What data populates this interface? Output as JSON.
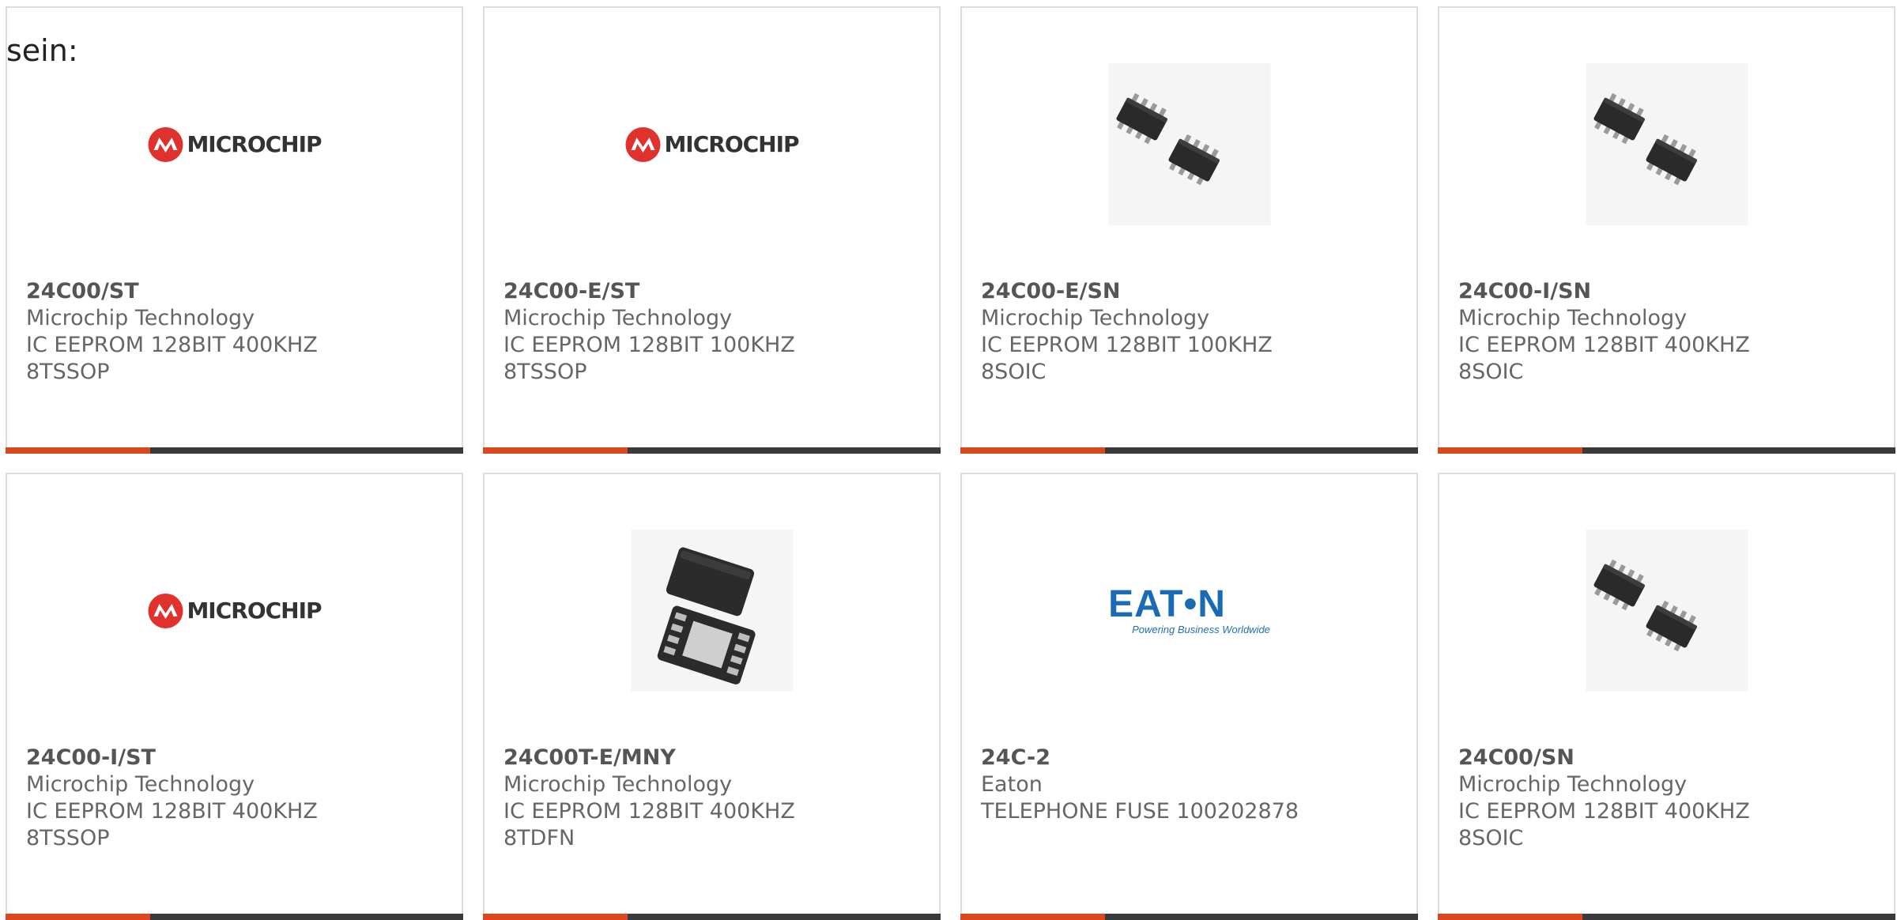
{
  "intro_text": "sein:",
  "colors": {
    "accent": "#d9481f",
    "bar": "#3a3a3a",
    "microchip_red": "#e0312d",
    "eaton_blue": "#1a6bb5"
  },
  "products": [
    {
      "part_number": "24C00/ST",
      "manufacturer": "Microchip Technology",
      "desc1": "IC EEPROM 128BIT 400KHZ",
      "desc2": "8TSSOP",
      "image": "microchip-logo"
    },
    {
      "part_number": "24C00-E/ST",
      "manufacturer": "Microchip Technology",
      "desc1": "IC EEPROM 128BIT 100KHZ",
      "desc2": "8TSSOP",
      "image": "microchip-logo"
    },
    {
      "part_number": "24C00-E/SN",
      "manufacturer": "Microchip Technology",
      "desc1": "IC EEPROM 128BIT 100KHZ",
      "desc2": "8SOIC",
      "image": "soic-chip-photo"
    },
    {
      "part_number": "24C00-I/SN",
      "manufacturer": "Microchip Technology",
      "desc1": "IC EEPROM 128BIT 400KHZ",
      "desc2": "8SOIC",
      "image": "soic-chip-photo"
    },
    {
      "part_number": "24C00-I/ST",
      "manufacturer": "Microchip Technology",
      "desc1": "IC EEPROM 128BIT 400KHZ",
      "desc2": "8TSSOP",
      "image": "microchip-logo"
    },
    {
      "part_number": "24C00T-E/MNY",
      "manufacturer": "Microchip Technology",
      "desc1": "IC EEPROM 128BIT 400KHZ",
      "desc2": "8TDFN",
      "image": "tdfn-chip-photo"
    },
    {
      "part_number": "24C-2",
      "manufacturer": "Eaton",
      "desc1": "TELEPHONE FUSE 100202878",
      "desc2": "",
      "image": "eaton-logo"
    },
    {
      "part_number": "24C00/SN",
      "manufacturer": "Microchip Technology",
      "desc1": "IC EEPROM 128BIT 400KHZ",
      "desc2": "8SOIC",
      "image": "soic-chip-photo"
    }
  ],
  "logos": {
    "microchip_word": "MICROCHIP",
    "eaton_word": "EAT•N",
    "eaton_tagline": "Powering Business Worldwide"
  }
}
